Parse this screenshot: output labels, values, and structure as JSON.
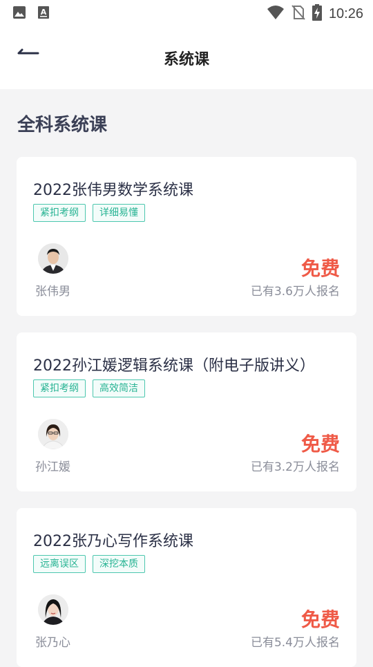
{
  "status_bar": {
    "time": "10:26",
    "icons": [
      "image-icon",
      "a-keyboard-icon",
      "wifi-icon",
      "no-sim-icon",
      "battery-charging-icon"
    ]
  },
  "header": {
    "title": "系统课",
    "back_icon": "back-arrow-icon"
  },
  "section": {
    "title": "全科系统课"
  },
  "courses": [
    {
      "title": "2022张伟男数学系统课",
      "tags": [
        "紧扣考纲",
        "详细易懂"
      ],
      "teacher": "张伟男",
      "price": "免费",
      "enroll": "已有3.6万人报名"
    },
    {
      "title": "2022孙江媛逻辑系统课（附电子版讲义）",
      "tags": [
        "紧扣考纲",
        "高效简洁"
      ],
      "teacher": "孙江媛",
      "price": "免费",
      "enroll": "已有3.2万人报名"
    },
    {
      "title": "2022张乃心写作系统课",
      "tags": [
        "远离误区",
        "深挖本质"
      ],
      "teacher": "张乃心",
      "price": "免费",
      "enroll": "已有5.4万人报名"
    }
  ],
  "colors": {
    "accent_green": "#27b393",
    "price_red": "#ef5a47",
    "page_bg": "#f4f4f5"
  }
}
